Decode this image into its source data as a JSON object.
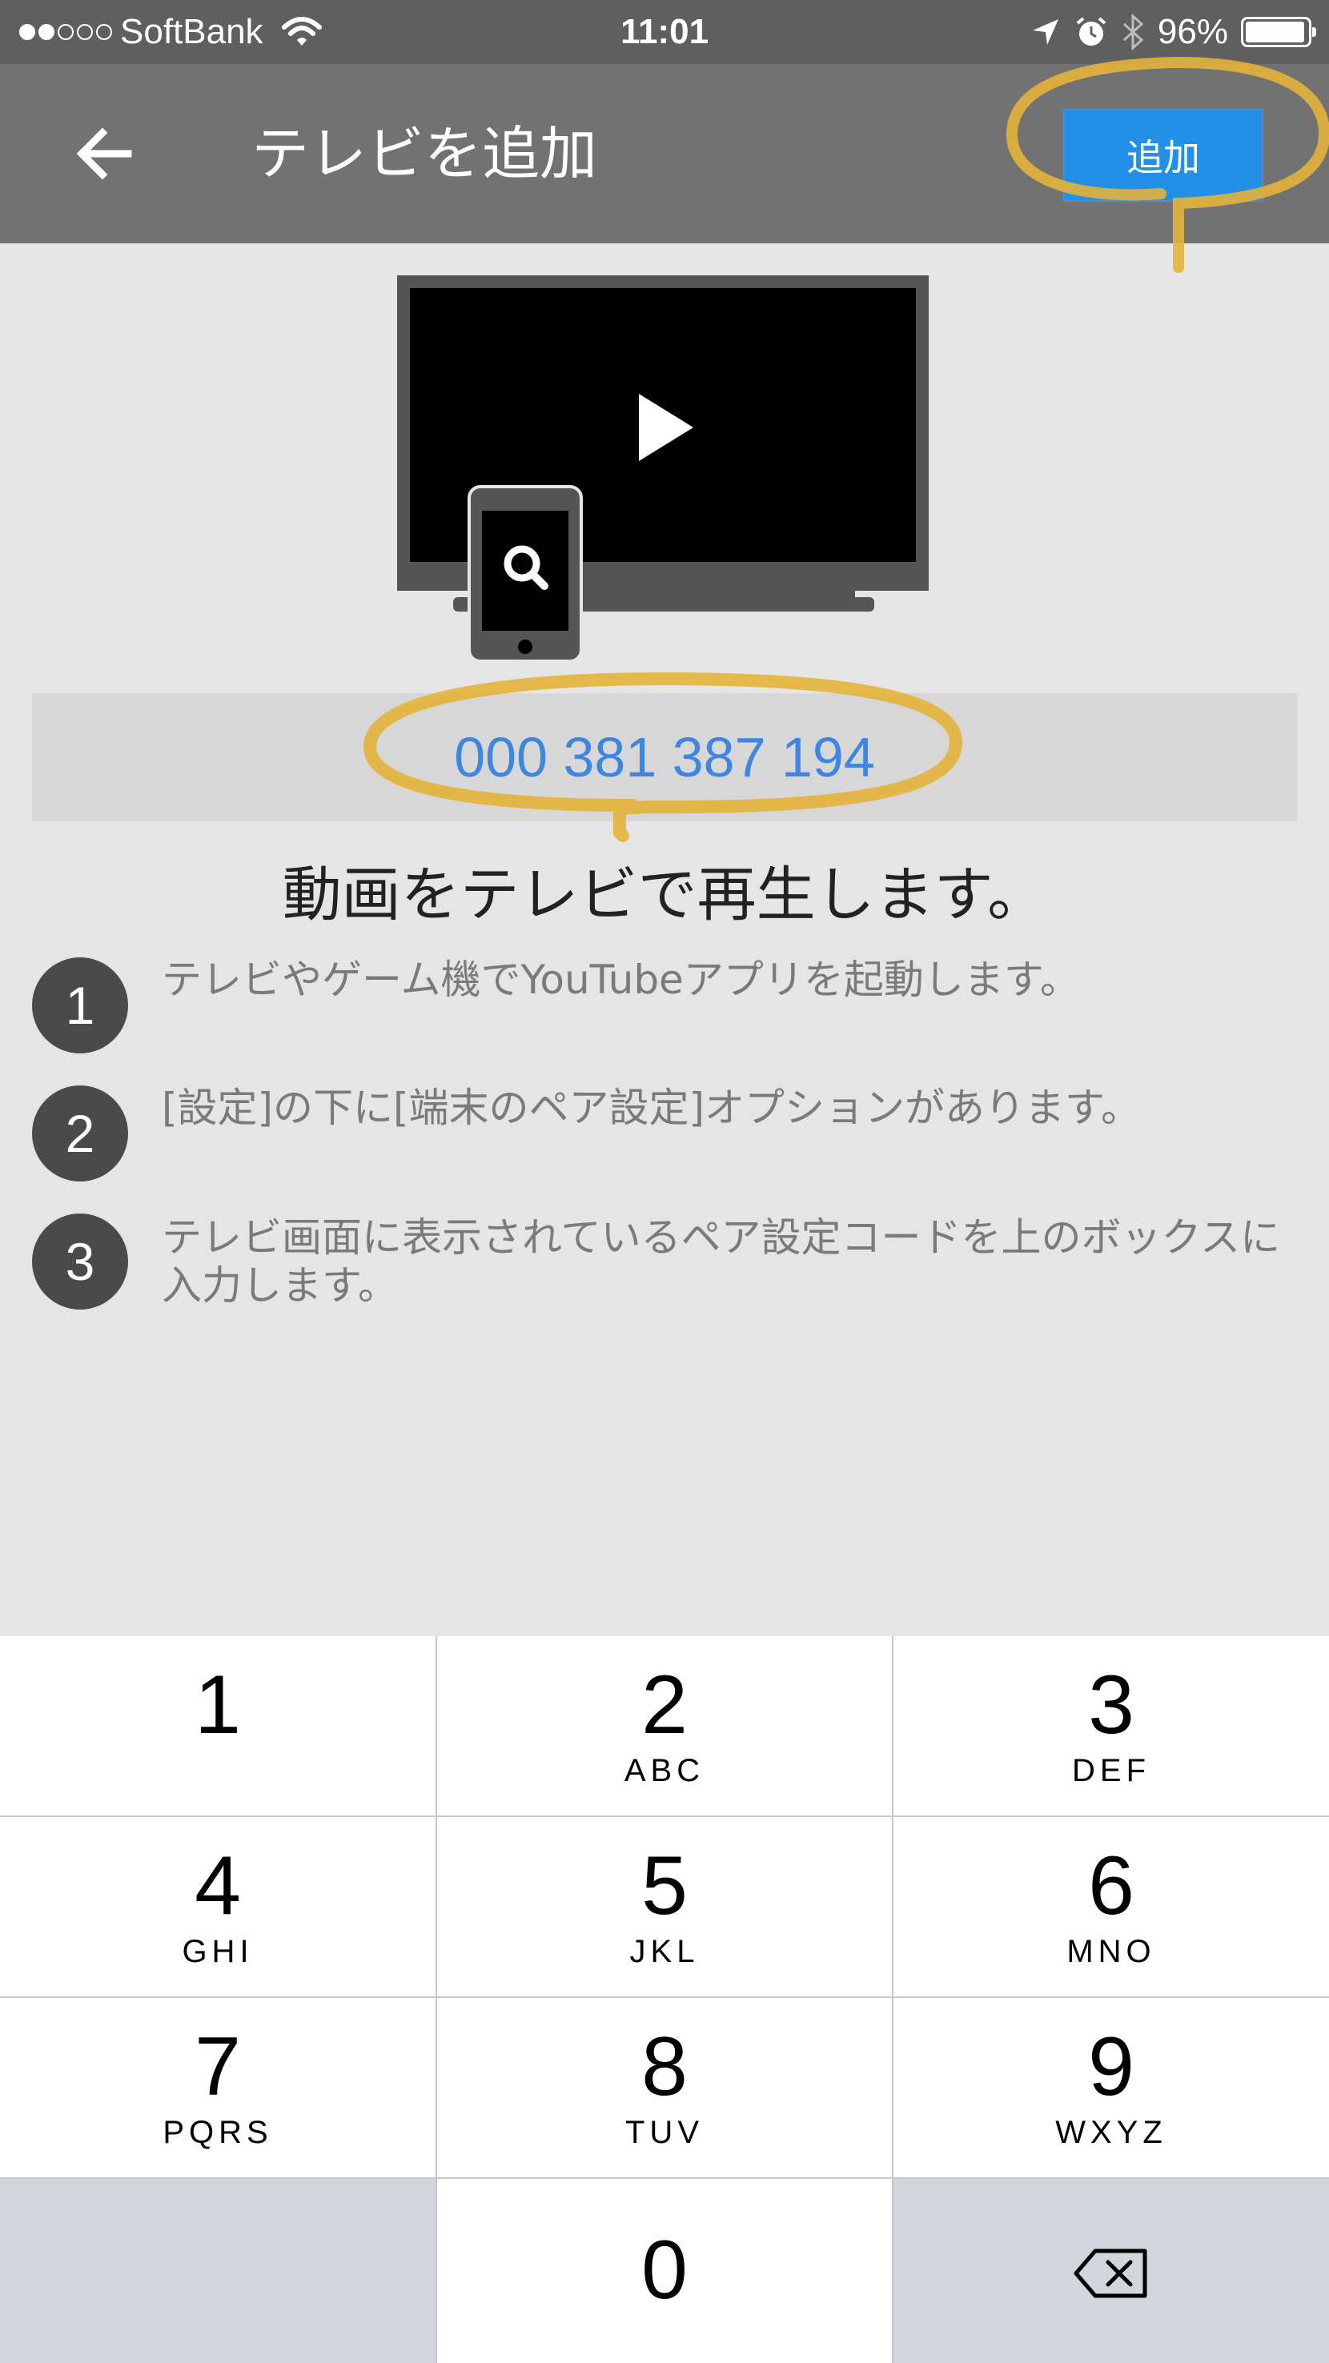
{
  "status_bar": {
    "signal_filled": 2,
    "signal_total": 5,
    "carrier": "SoftBank",
    "time": "11:01",
    "battery_percent_text": "96%",
    "battery_level": 0.96,
    "icons": [
      "wifi-icon",
      "location-arrow-icon",
      "alarm-icon",
      "bluetooth-icon",
      "battery-icon"
    ]
  },
  "appbar": {
    "back_icon": "arrow-left-icon",
    "title": "テレビを追加",
    "add_label": "追加"
  },
  "pairing": {
    "code": "000 381 387 194"
  },
  "headline": "動画をテレビで再生します。",
  "steps": [
    {
      "num": "1",
      "text": "テレビやゲーム機でYouTubeアプリを起動します。"
    },
    {
      "num": "2",
      "text": "[設定]の下に[端末のペア設定]オプションがあります。"
    },
    {
      "num": "3",
      "text": "テレビ画面に表示されているペア設定コードを上のボックスに入力します。"
    }
  ],
  "keypad": {
    "keys": [
      {
        "digit": "1",
        "letters": ""
      },
      {
        "digit": "2",
        "letters": "ABC"
      },
      {
        "digit": "3",
        "letters": "DEF"
      },
      {
        "digit": "4",
        "letters": "GHI"
      },
      {
        "digit": "5",
        "letters": "JKL"
      },
      {
        "digit": "6",
        "letters": "MNO"
      },
      {
        "digit": "7",
        "letters": "PQRS"
      },
      {
        "digit": "8",
        "letters": "TUV"
      },
      {
        "digit": "9",
        "letters": "WXYZ"
      },
      {
        "digit": "0",
        "letters": ""
      }
    ],
    "delete_icon": "backspace-icon"
  },
  "colors": {
    "status_bar": "#5f5f5f",
    "app_bar": "#727272",
    "accent_button": "#2390e8",
    "code_text": "#3e86e0",
    "annotation": "#e8b73a",
    "background": "#e5e5e5"
  }
}
